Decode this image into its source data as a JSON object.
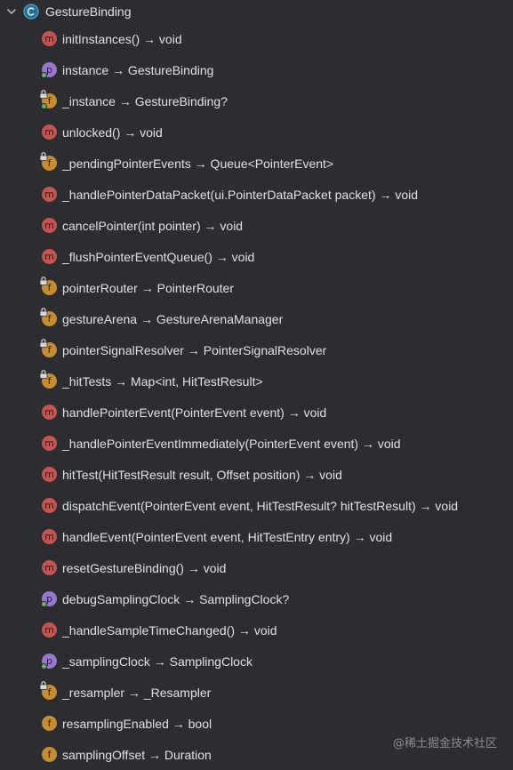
{
  "root": {
    "label": "GestureBinding",
    "icon": "class-icon",
    "expanded": true
  },
  "members": [
    {
      "kind": "m",
      "label": "initInstances() → void",
      "lock": false,
      "dot": false
    },
    {
      "kind": "p",
      "label": "instance → GestureBinding",
      "lock": false,
      "dot": true
    },
    {
      "kind": "f",
      "label": "_instance → GestureBinding?",
      "lock": true,
      "dot": true
    },
    {
      "kind": "m",
      "label": "unlocked() → void",
      "lock": false,
      "dot": false
    },
    {
      "kind": "f",
      "label": "_pendingPointerEvents → Queue<PointerEvent>",
      "lock": true,
      "dot": false
    },
    {
      "kind": "m",
      "label": "_handlePointerDataPacket(ui.PointerDataPacket packet) → void",
      "lock": false,
      "dot": false
    },
    {
      "kind": "m",
      "label": "cancelPointer(int pointer) → void",
      "lock": false,
      "dot": false
    },
    {
      "kind": "m",
      "label": "_flushPointerEventQueue() → void",
      "lock": false,
      "dot": false
    },
    {
      "kind": "f",
      "label": "pointerRouter → PointerRouter",
      "lock": true,
      "dot": false
    },
    {
      "kind": "f",
      "label": "gestureArena → GestureArenaManager",
      "lock": true,
      "dot": false
    },
    {
      "kind": "f",
      "label": "pointerSignalResolver → PointerSignalResolver",
      "lock": true,
      "dot": false
    },
    {
      "kind": "f",
      "label": "_hitTests → Map<int, HitTestResult>",
      "lock": true,
      "dot": false
    },
    {
      "kind": "m",
      "label": "handlePointerEvent(PointerEvent event) → void",
      "lock": false,
      "dot": false
    },
    {
      "kind": "m",
      "label": "_handlePointerEventImmediately(PointerEvent event) → void",
      "lock": false,
      "dot": false
    },
    {
      "kind": "m",
      "label": "hitTest(HitTestResult result, Offset position) → void",
      "lock": false,
      "dot": false
    },
    {
      "kind": "m",
      "label": "dispatchEvent(PointerEvent event, HitTestResult? hitTestResult) → void",
      "lock": false,
      "dot": false
    },
    {
      "kind": "m",
      "label": "handleEvent(PointerEvent event, HitTestEntry entry) → void",
      "lock": false,
      "dot": false
    },
    {
      "kind": "m",
      "label": "resetGestureBinding() → void",
      "lock": false,
      "dot": false
    },
    {
      "kind": "p",
      "label": "debugSamplingClock → SamplingClock?",
      "lock": false,
      "dot": true
    },
    {
      "kind": "m",
      "label": "_handleSampleTimeChanged() → void",
      "lock": false,
      "dot": false
    },
    {
      "kind": "p",
      "label": "_samplingClock → SamplingClock",
      "lock": false,
      "dot": true
    },
    {
      "kind": "f",
      "label": "_resampler → _Resampler",
      "lock": true,
      "dot": false
    },
    {
      "kind": "f",
      "label": "resamplingEnabled → bool",
      "lock": false,
      "dot": false
    },
    {
      "kind": "f",
      "label": "samplingOffset → Duration",
      "lock": false,
      "dot": false
    }
  ],
  "watermark": "@稀土掘金技术社区",
  "colors": {
    "background": "#2b2d30",
    "method": "#c75450",
    "property": "#9876d2",
    "field": "#c98d2d",
    "text": "#dfe1e5"
  }
}
